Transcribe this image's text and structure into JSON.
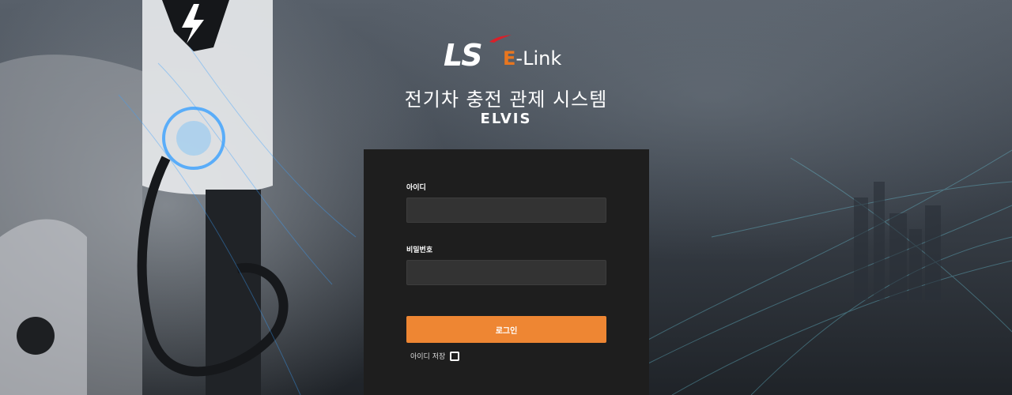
{
  "brand": {
    "logo_ls": "LS",
    "logo_elink_prefix": "E",
    "logo_elink_suffix": "-Link",
    "accent_color": "#e8761f",
    "swoosh_color": "#d8202a"
  },
  "header": {
    "title": "전기차 충전 관제 시스템",
    "subtitle": "ELVIS"
  },
  "login": {
    "id_label": "아이디",
    "id_value": "",
    "password_label": "비밀번호",
    "password_value": "",
    "submit_label": "로그인",
    "submit_color": "#ee8633",
    "remember_label": "아이디 저장",
    "remember_checked": false
  },
  "background": {
    "scene": "ev-charger-plugged-into-car",
    "glow_color": "#3aa0ff"
  }
}
